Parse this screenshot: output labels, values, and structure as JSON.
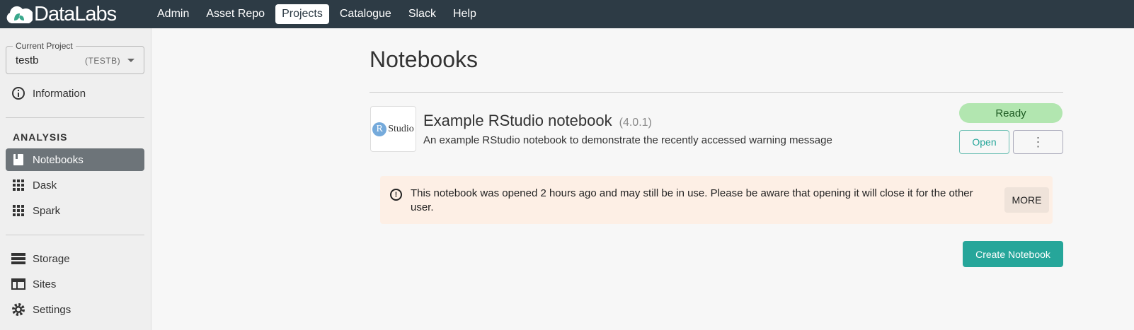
{
  "app": {
    "logo": "DataLabs"
  },
  "nav": [
    {
      "label": "Admin"
    },
    {
      "label": "Asset Repo"
    },
    {
      "label": "Projects",
      "active": true
    },
    {
      "label": "Catalogue"
    },
    {
      "label": "Slack"
    },
    {
      "label": "Help"
    }
  ],
  "sidebar": {
    "project": {
      "label": "Current Project",
      "name": "testb",
      "code": "(TESTB)"
    },
    "information": "Information",
    "section": "ANALYSIS",
    "items": [
      {
        "label": "Notebooks"
      },
      {
        "label": "Dask"
      },
      {
        "label": "Spark"
      }
    ],
    "bottom": [
      {
        "label": "Storage"
      },
      {
        "label": "Sites"
      },
      {
        "label": "Settings"
      }
    ]
  },
  "main": {
    "title": "Notebooks",
    "notebook": {
      "icon_text": "Studio",
      "icon_letter": "R",
      "name": "Example RStudio notebook",
      "version": "(4.0.1)",
      "description": "An example RStudio notebook to demonstrate the recently accessed warning message",
      "status": "Ready",
      "open": "Open",
      "menu": "⋮"
    },
    "warning": {
      "icon": "!",
      "text": "This notebook was opened 2 hours ago and may still be in use. Please be aware that opening it will close it for the other user.",
      "more": "MORE"
    },
    "create": "Create Notebook"
  },
  "colors": {
    "topbar": "#2d3b45",
    "accent": "#26a69a",
    "ready": "#b2e6b0",
    "warning_bg": "#fdefe5"
  }
}
